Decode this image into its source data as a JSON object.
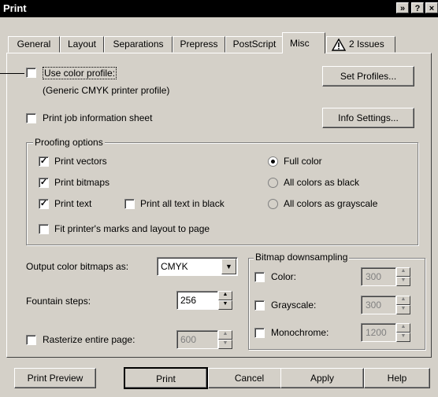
{
  "window": {
    "title": "Print"
  },
  "tabs": [
    {
      "label": "General"
    },
    {
      "label": "Layout"
    },
    {
      "label": "Separations"
    },
    {
      "label": "Prepress"
    },
    {
      "label": "PostScript"
    },
    {
      "label": "Misc"
    },
    {
      "label": "2 Issues"
    }
  ],
  "misc": {
    "use_color_profile": "Use color profile:",
    "profile_name": "(Generic CMYK printer profile)",
    "set_profiles": "Set Profiles...",
    "print_job_info": "Print job information sheet",
    "info_settings": "Info Settings...",
    "proofing_title": "Proofing options",
    "print_vectors": "Print vectors",
    "print_bitmaps": "Print bitmaps",
    "print_text": "Print text",
    "print_all_text_black": "Print all text in black",
    "fit_marks": "Fit printer's marks and layout to page",
    "full_color": "Full color",
    "all_black": "All colors as black",
    "all_grayscale": "All colors as grayscale",
    "output_label": "Output color bitmaps as:",
    "output_value": "CMYK",
    "fountain_label": "Fountain steps:",
    "fountain_value": "256",
    "rasterize_label": "Rasterize entire page:",
    "rasterize_value": "600",
    "downsampling_title": "Bitmap downsampling",
    "color_label": "Color:",
    "color_value": "300",
    "grayscale_label": "Grayscale:",
    "grayscale_value": "300",
    "mono_label": "Monochrome:",
    "mono_value": "1200"
  },
  "buttons": {
    "print_preview": "Print Preview",
    "print": "Print",
    "cancel": "Cancel",
    "apply": "Apply",
    "help": "Help"
  }
}
